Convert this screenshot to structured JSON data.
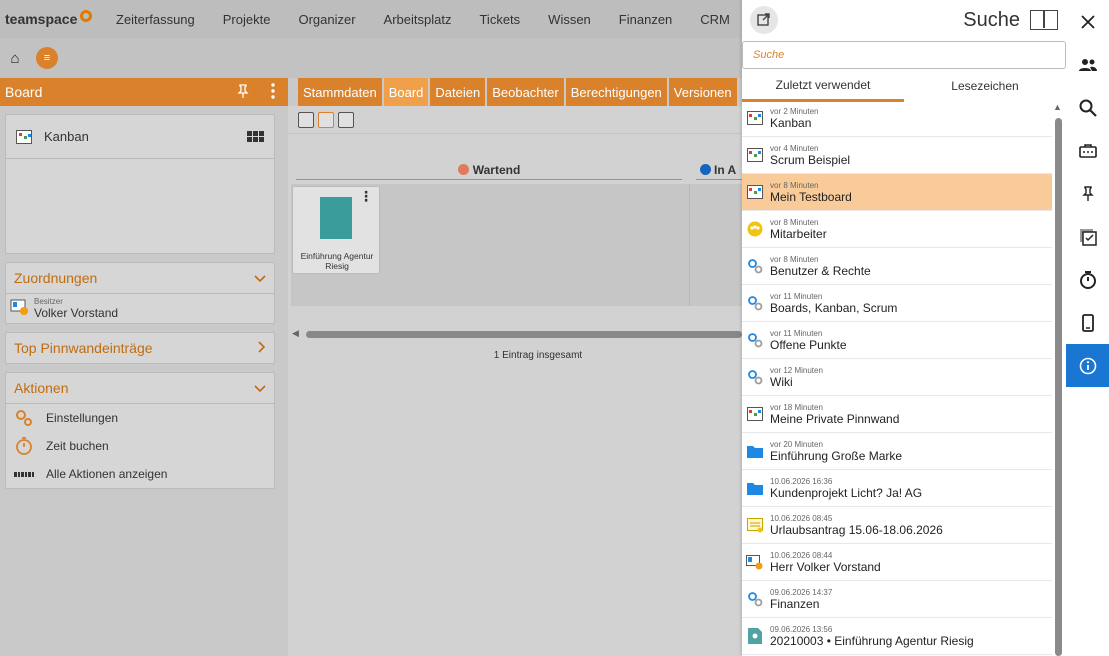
{
  "app": {
    "logo_text": "teamspace"
  },
  "nav": {
    "items": [
      "Zeiterfassung",
      "Projekte",
      "Organizer",
      "Arbeitsplatz",
      "Tickets",
      "Wissen",
      "Finanzen",
      "CRM"
    ]
  },
  "subbar": {
    "home": "⌂",
    "menu": "≡"
  },
  "left": {
    "title": "Board",
    "kanban_label": "Kanban",
    "sections": {
      "assignments": "Zuordnungen",
      "pinboard": "Top Pinnwandeinträge",
      "actions": "Aktionen"
    },
    "owner_label": "Besitzer",
    "owner_name": "Volker Vorstand",
    "actions": [
      "Einstellungen",
      "Zeit buchen",
      "Alle Aktionen anzeigen"
    ]
  },
  "center": {
    "tabs": [
      "Stammdaten",
      "Board",
      "Dateien",
      "Beobachter",
      "Berechtigungen",
      "Versionen"
    ],
    "active_tab": "Board",
    "lanes": [
      "Wartend",
      "In A"
    ],
    "task_caption": "Einführung Agentur Riesig",
    "count_text": "1 Eintrag insgesamt"
  },
  "search": {
    "title": "Suche",
    "placeholder": "Suche",
    "tabs": [
      "Zuletzt verwendet",
      "Lesezeichen"
    ],
    "items": [
      {
        "when": "vor 2 Minuten",
        "name": "Kanban",
        "icon": "board-icon"
      },
      {
        "when": "vor 4 Minuten",
        "name": "Scrum Beispiel",
        "icon": "board-icon"
      },
      {
        "when": "vor 8 Minuten",
        "name": "Mein Testboard",
        "icon": "board-icon"
      },
      {
        "when": "vor 8 Minuten",
        "name": "Mitarbeiter",
        "icon": "team-icon"
      },
      {
        "when": "vor 8 Minuten",
        "name": "Benutzer & Rechte",
        "icon": "gears-icon"
      },
      {
        "when": "vor 11 Minuten",
        "name": "Boards, Kanban, Scrum",
        "icon": "gears-icon"
      },
      {
        "when": "vor 11 Minuten",
        "name": "Offene Punkte",
        "icon": "gears-icon"
      },
      {
        "when": "vor 12 Minuten",
        "name": "Wiki",
        "icon": "gears-icon"
      },
      {
        "when": "vor 18 Minuten",
        "name": "Meine Private Pinnwand",
        "icon": "board-icon"
      },
      {
        "when": "vor 20 Minuten",
        "name": "Einführung Große Marke",
        "icon": "folder-icon"
      },
      {
        "when": "10.06.2026 16:36",
        "name": "Kundenprojekt Licht? Ja! AG",
        "icon": "folder-icon"
      },
      {
        "when": "10.06.2026 08:45",
        "name": "Urlaubsantrag 15.06-18.06.2026",
        "icon": "calendar-icon"
      },
      {
        "when": "10.06.2026 08:44",
        "name": "Herr Volker Vorstand",
        "icon": "contact-icon"
      },
      {
        "when": "09.06.2026 14:37",
        "name": "Finanzen",
        "icon": "gears-icon"
      },
      {
        "when": "09.06.2026 13:56",
        "name": "20210003 • Einführung Agentur Riesig",
        "icon": "document-icon"
      }
    ],
    "selected_index": 2
  },
  "rail": {
    "items": [
      "close-icon",
      "users-icon",
      "search-icon",
      "ticket-icon",
      "pin-icon",
      "checklist-icon",
      "stopwatch-icon",
      "mobile-icon",
      "info-icon"
    ],
    "active": "info-icon"
  },
  "colors": {
    "accent": "#d9822b",
    "selection": "#f9cb98",
    "rail_active": "#1976d2"
  }
}
